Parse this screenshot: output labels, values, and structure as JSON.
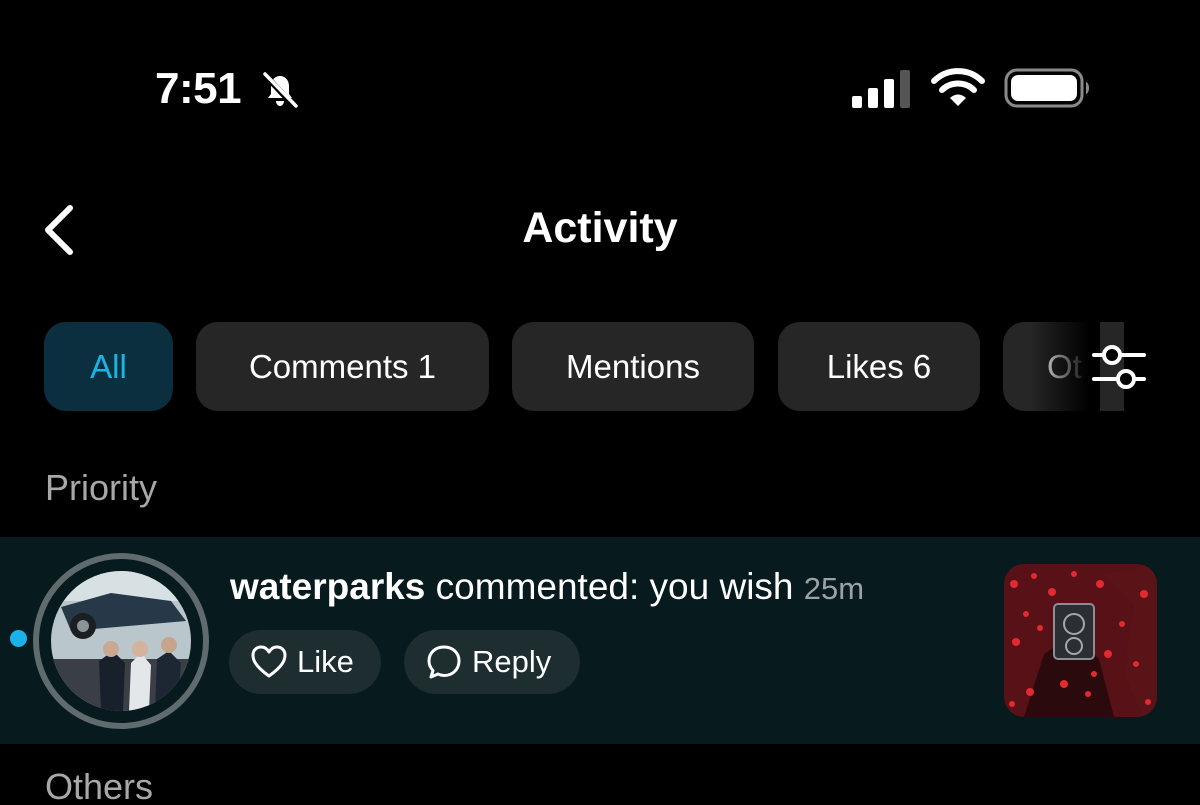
{
  "status_bar": {
    "time": "7:51",
    "icons": [
      "bell-slash-icon",
      "cellular-signal-icon",
      "wifi-icon",
      "battery-icon"
    ]
  },
  "header": {
    "title": "Activity",
    "back_icon": "chevron-left-icon"
  },
  "filters": {
    "chips": [
      {
        "label": "All",
        "active": true
      },
      {
        "label": "Comments 1",
        "active": false
      },
      {
        "label": "Mentions",
        "active": false
      },
      {
        "label": "Likes 6",
        "active": false
      },
      {
        "label": "Ot",
        "active": false
      }
    ],
    "filter_icon": "sliders-icon"
  },
  "sections": {
    "priority": "Priority",
    "others": "Others"
  },
  "notification": {
    "username": "waterparks",
    "action": "commented: you wish",
    "time": "25m",
    "like_label": "Like",
    "reply_label": "Reply",
    "unread": true
  },
  "colors": {
    "accent": "#17b6e3",
    "chip_bg": "#262626",
    "active_chip_bg": "#0b2f3f",
    "row_bg": "#071a1d",
    "dot": "#1ab3e8"
  }
}
